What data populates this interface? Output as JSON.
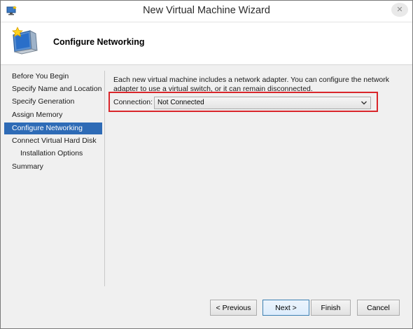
{
  "window": {
    "title": "New Virtual Machine Wizard",
    "close_glyph": "✕"
  },
  "header": {
    "page_title": "Configure Networking",
    "icon": "monitor-star-icon"
  },
  "sidebar": {
    "items": [
      {
        "label": "Before You Begin",
        "active": false,
        "indent": false
      },
      {
        "label": "Specify Name and Location",
        "active": false,
        "indent": false
      },
      {
        "label": "Specify Generation",
        "active": false,
        "indent": false
      },
      {
        "label": "Assign Memory",
        "active": false,
        "indent": false
      },
      {
        "label": "Configure Networking",
        "active": true,
        "indent": false
      },
      {
        "label": "Connect Virtual Hard Disk",
        "active": false,
        "indent": false
      },
      {
        "label": "Installation Options",
        "active": false,
        "indent": true
      },
      {
        "label": "Summary",
        "active": false,
        "indent": false
      }
    ]
  },
  "main": {
    "description": "Each new virtual machine includes a network adapter. You can configure the network adapter to use a virtual switch, or it can remain disconnected.",
    "connection_label": "Connection:",
    "connection_value": "Not Connected"
  },
  "buttons": {
    "previous": "< Previous",
    "next": "Next >",
    "finish": "Finish",
    "cancel": "Cancel"
  },
  "colors": {
    "active_item": "#2e6bb6",
    "highlight_border": "#d9262b"
  }
}
